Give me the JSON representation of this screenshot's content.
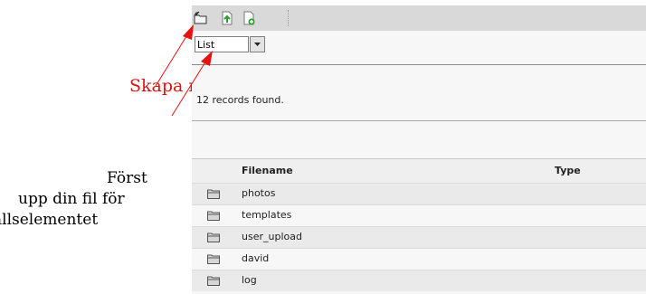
{
  "annotation": {
    "label": "Skapa mapp"
  },
  "body_text": {
    "lines": [
      "Först",
      "upp din fil för",
      "ållselementet"
    ]
  },
  "toolbar": {
    "icons": [
      "new-folder-icon",
      "upload-file-icon",
      "new-file-icon"
    ]
  },
  "view_selector": {
    "selected": "List"
  },
  "status": {
    "records_text": "12 records found."
  },
  "file_list": {
    "columns": [
      "Filename",
      "Type"
    ],
    "rows": [
      {
        "name": "photos"
      },
      {
        "name": "templates"
      },
      {
        "name": "user_upload"
      },
      {
        "name": "david"
      },
      {
        "name": "log"
      }
    ]
  },
  "colors": {
    "annotation": "#e8100f",
    "toolbar": "#d9d9d9"
  }
}
